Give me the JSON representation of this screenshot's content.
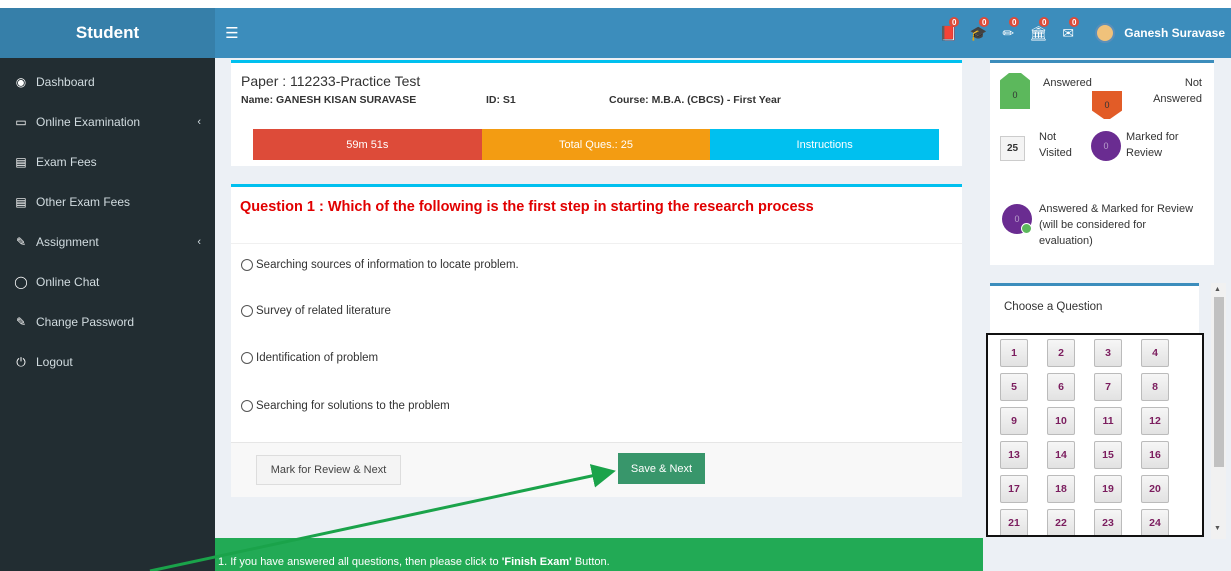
{
  "header": {
    "brand": "Student",
    "menu_icon": "hamburger-icon",
    "notification_icons": [
      {
        "name": "book-icon",
        "count": "0"
      },
      {
        "name": "graduation-cap-icon",
        "count": "0"
      },
      {
        "name": "pencil-icon",
        "count": "0"
      },
      {
        "name": "building-icon",
        "count": "0"
      },
      {
        "name": "envelope-icon",
        "count": "0"
      }
    ],
    "user_name": "Ganesh Suravase"
  },
  "sidebar": {
    "items": [
      {
        "label": "Dashboard",
        "icon": "dashboard-icon"
      },
      {
        "label": "Online Examination",
        "icon": "laptop-icon",
        "has_caret": true
      },
      {
        "label": "Exam Fees",
        "icon": "file-icon"
      },
      {
        "label": "Other Exam Fees",
        "icon": "file-icon"
      },
      {
        "label": "Assignment",
        "icon": "pencil-icon",
        "has_caret": true
      },
      {
        "label": "Online Chat",
        "icon": "chat-icon"
      },
      {
        "label": "Change Password",
        "icon": "edit-icon"
      },
      {
        "label": "Logout",
        "icon": "power-icon"
      }
    ]
  },
  "exam": {
    "paper": "Paper : 112233-Practice Test",
    "name": "Name: GANESH KISAN SURAVASE",
    "id": "ID: S1",
    "course": "Course: M.B.A. (CBCS) - First Year",
    "timer": "59m 51s",
    "total_questions": "Total Ques.: 25",
    "instructions": "Instructions"
  },
  "question": {
    "title": "Question 1 : Which of the following is the first step in starting the research process",
    "options": [
      "Searching sources of information to locate problem.",
      "Survey of related literature",
      "Identification of problem",
      "Searching for solutions to the problem"
    ],
    "review_button": "Mark for Review & Next",
    "save_button": "Save & Next"
  },
  "legend": {
    "answered": "Answered",
    "answered_count": "0",
    "not_answered": "Not Answered",
    "not_answered_count": "0",
    "not_visited": "Not Visited",
    "not_visited_count": "25",
    "marked": "Marked for Review",
    "marked_count": "0",
    "answered_marked": "Answered & Marked for Review (will be considered for evaluation)",
    "answered_marked_count": "0"
  },
  "palette": {
    "title": "Choose a Question",
    "numbers": [
      "1",
      "2",
      "3",
      "4",
      "5",
      "6",
      "7",
      "8",
      "9",
      "10",
      "11",
      "12",
      "13",
      "14",
      "15",
      "16",
      "17",
      "18",
      "19",
      "20",
      "21",
      "22",
      "23",
      "24"
    ]
  },
  "notice": {
    "prefix": "1. If you have answered all questions, then please click to ",
    "emphasis": "'Finish Exam'",
    "suffix": " Button."
  },
  "colors": {
    "header": "#3c8dbc",
    "sidebar": "#222d32",
    "timer": "#dd4b39",
    "total": "#f39c12",
    "instructions": "#00c0ef",
    "save": "#38966b",
    "notice": "#22aa55",
    "question_title": "#e10000"
  }
}
